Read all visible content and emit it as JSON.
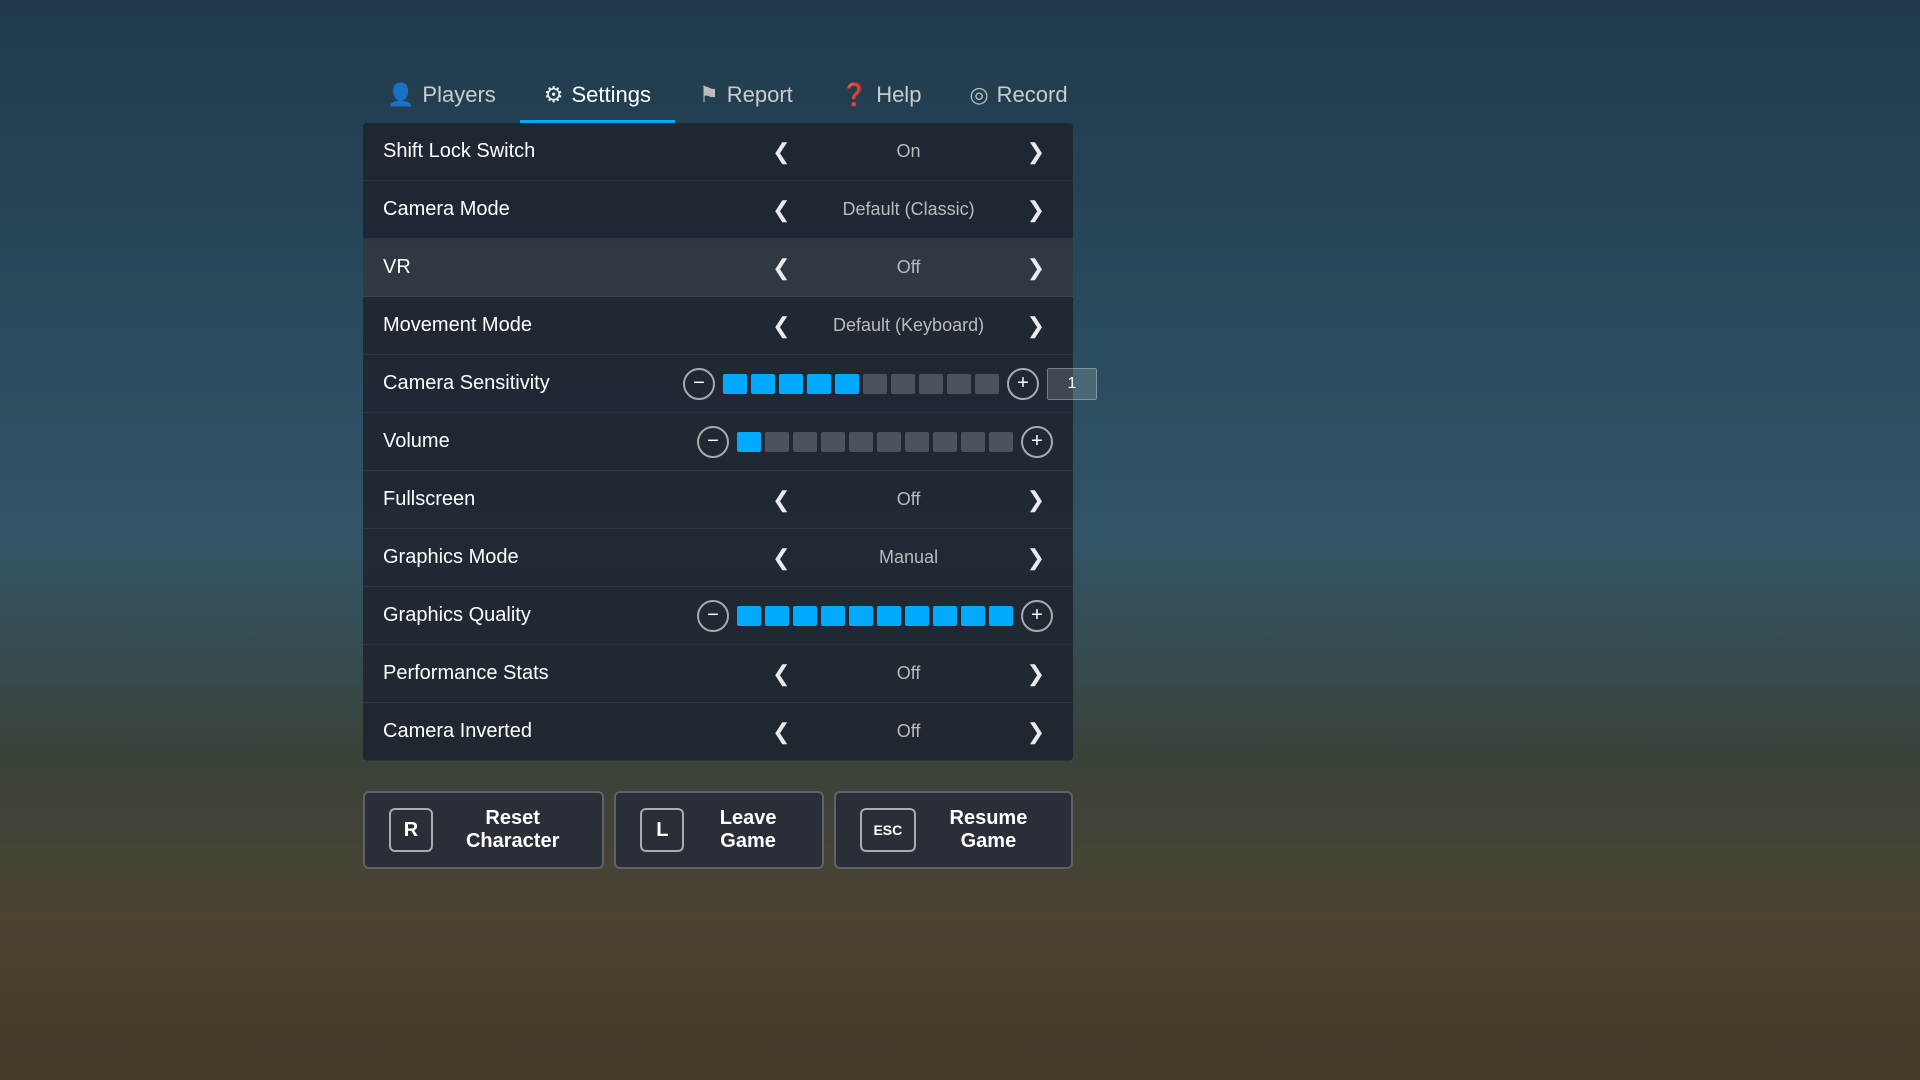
{
  "background": {
    "overlay_color": "rgba(0,0,0,0.45)"
  },
  "tabs": [
    {
      "id": "players",
      "label": "Players",
      "icon": "👤",
      "active": false
    },
    {
      "id": "settings",
      "label": "Settings",
      "icon": "⚙️",
      "active": true
    },
    {
      "id": "report",
      "label": "Report",
      "icon": "🚩",
      "active": false
    },
    {
      "id": "help",
      "label": "Help",
      "icon": "❓",
      "active": false
    },
    {
      "id": "record",
      "label": "Record",
      "icon": "⊙",
      "active": false
    }
  ],
  "settings": [
    {
      "id": "shift-lock",
      "label": "Shift Lock Switch",
      "type": "toggle",
      "value": "On",
      "highlighted": false
    },
    {
      "id": "camera-mode",
      "label": "Camera Mode",
      "type": "toggle",
      "value": "Default (Classic)",
      "highlighted": false
    },
    {
      "id": "vr",
      "label": "VR",
      "type": "toggle",
      "value": "Off",
      "highlighted": true
    },
    {
      "id": "movement-mode",
      "label": "Movement Mode",
      "type": "toggle",
      "value": "Default (Keyboard)",
      "highlighted": false
    },
    {
      "id": "camera-sensitivity",
      "label": "Camera Sensitivity",
      "type": "slider",
      "filled_bars": 5,
      "total_bars": 10,
      "value": 1,
      "highlighted": false
    },
    {
      "id": "volume",
      "label": "Volume",
      "type": "slider",
      "filled_bars": 1,
      "total_bars": 10,
      "value": null,
      "highlighted": false
    },
    {
      "id": "fullscreen",
      "label": "Fullscreen",
      "type": "toggle",
      "value": "Off",
      "highlighted": false
    },
    {
      "id": "graphics-mode",
      "label": "Graphics Mode",
      "type": "toggle",
      "value": "Manual",
      "highlighted": false
    },
    {
      "id": "graphics-quality",
      "label": "Graphics Quality",
      "type": "slider",
      "filled_bars": 10,
      "total_bars": 10,
      "value": null,
      "highlighted": false
    },
    {
      "id": "performance-stats",
      "label": "Performance Stats",
      "type": "toggle",
      "value": "Off",
      "highlighted": false
    },
    {
      "id": "camera-inverted",
      "label": "Camera Inverted",
      "type": "toggle",
      "value": "Off",
      "highlighted": false
    }
  ],
  "buttons": [
    {
      "id": "reset",
      "key": "R",
      "label": "Reset Character"
    },
    {
      "id": "leave",
      "key": "L",
      "label": "Leave Game"
    },
    {
      "id": "resume",
      "key": "ESC",
      "label": "Resume Game"
    }
  ]
}
